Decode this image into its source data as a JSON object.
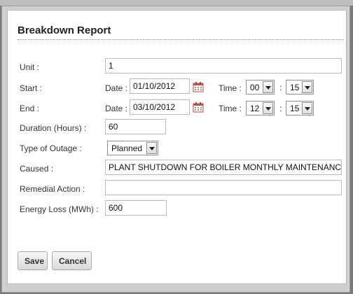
{
  "dialog": {
    "title": "Breakdown Report"
  },
  "form": {
    "unit": {
      "label": "Unit :",
      "value": "1"
    },
    "start": {
      "label": "Start :",
      "date_label": "Date :",
      "date": "01/10/2012",
      "time_label": "Time :",
      "hour": "00",
      "minute": "15",
      "sep": ":"
    },
    "end": {
      "label": "End :",
      "date_label": "Date :",
      "date": "03/10/2012",
      "time_label": "Time :",
      "hour": "12",
      "minute": "15",
      "sep": ":"
    },
    "duration": {
      "label": "Duration (Hours) :",
      "value": "60"
    },
    "outage": {
      "label": "Type of Outage :",
      "value": "Planned"
    },
    "caused": {
      "label": "Caused :",
      "value": "PLANT SHUTDOWN FOR BOILER MONTHLY MAINTENANC"
    },
    "remedial": {
      "label": "Remedial Action :",
      "value": ""
    },
    "energy": {
      "label": "Energy Loss (MWh) :",
      "value": "600"
    }
  },
  "buttons": {
    "save": "Save",
    "cancel": "Cancel"
  },
  "icons": {
    "calendar": "calendar-icon",
    "dropdown": "chevron-down-icon"
  }
}
